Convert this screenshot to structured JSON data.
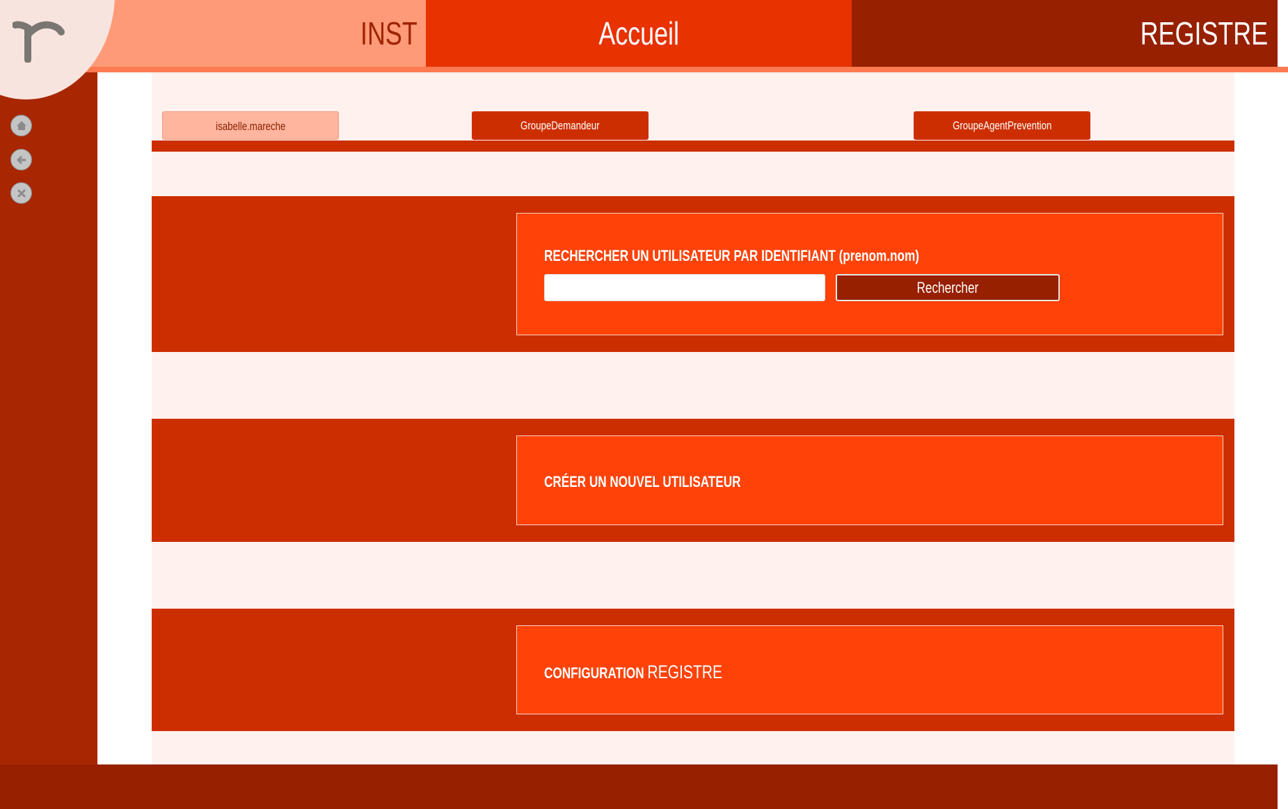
{
  "header": {
    "inst_label": "INST",
    "home_label": "Accueil",
    "registre_label": "REGISTRE"
  },
  "sidebar": {
    "logo_letter": "r",
    "buttons": [
      {
        "icon": "home-icon"
      },
      {
        "icon": "back-arrow-icon"
      },
      {
        "icon": "close-icon"
      }
    ]
  },
  "tabs": {
    "user": "isabelle.mareche",
    "group1": "GroupeDemandeur",
    "group2": "GroupeAgentPrevention"
  },
  "search": {
    "title": "RECHERCHER UN UTILISATEUR PAR IDENTIFIANT (prenom.nom)",
    "input_value": "",
    "button_label": "Rechercher"
  },
  "create_user": {
    "title": "CRÉER UN NOUVEL UTILISATEUR"
  },
  "configuration": {
    "title_bold": "CONFIGURATION",
    "title_light": "REGISTRE"
  },
  "colors": {
    "header_left": "#ff9a78",
    "header_center": "#e83200",
    "header_right": "#962000",
    "sidebar": "#a82600",
    "band": "#cc2e00",
    "card": "#ff4208",
    "panel_bg": "#fff1ee",
    "footer": "#962000"
  }
}
